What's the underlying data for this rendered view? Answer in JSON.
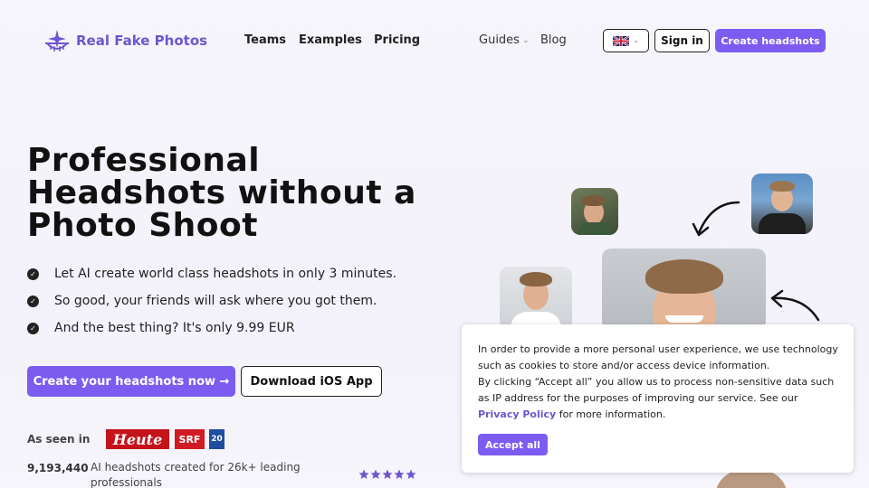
{
  "header": {
    "brand": "Real Fake Photos",
    "nav": [
      "Teams",
      "Examples",
      "Pricing"
    ],
    "guides": "Guides",
    "blog": "Blog",
    "sign_in": "Sign in",
    "create": "Create headshots",
    "language_icon": "uk-flag-icon"
  },
  "hero": {
    "title": "Professional Headshots without a Photo Shoot",
    "bullets": [
      "Let AI create world class headshots in only 3 minutes.",
      "So good, your friends will ask where you got them.",
      "And the best thing? It's only 9.99 EUR"
    ],
    "cta_primary": "Create your headshots now →",
    "cta_secondary": "Download iOS App",
    "seen_in": "As seen in",
    "press": [
      "Heute",
      "SRF",
      "20"
    ],
    "count": "9,193,440",
    "count_desc": "AI headshots created for 26k+ leading professionals",
    "rating_stars": 5
  },
  "cookie": {
    "line1": "In order to provide a more personal user experience, we use technology such as cookies to store and/or access device information.",
    "line2_pre": "By clicking “Accept all” you allow us to process non-sensitive data such as IP address for the purposes of improving our service. See our",
    "link": "Privacy Policy",
    "line2_post": "for more information.",
    "accept": "Accept all"
  },
  "colors": {
    "accent": "#7c5cf0",
    "brand_text": "#6e56cf"
  }
}
